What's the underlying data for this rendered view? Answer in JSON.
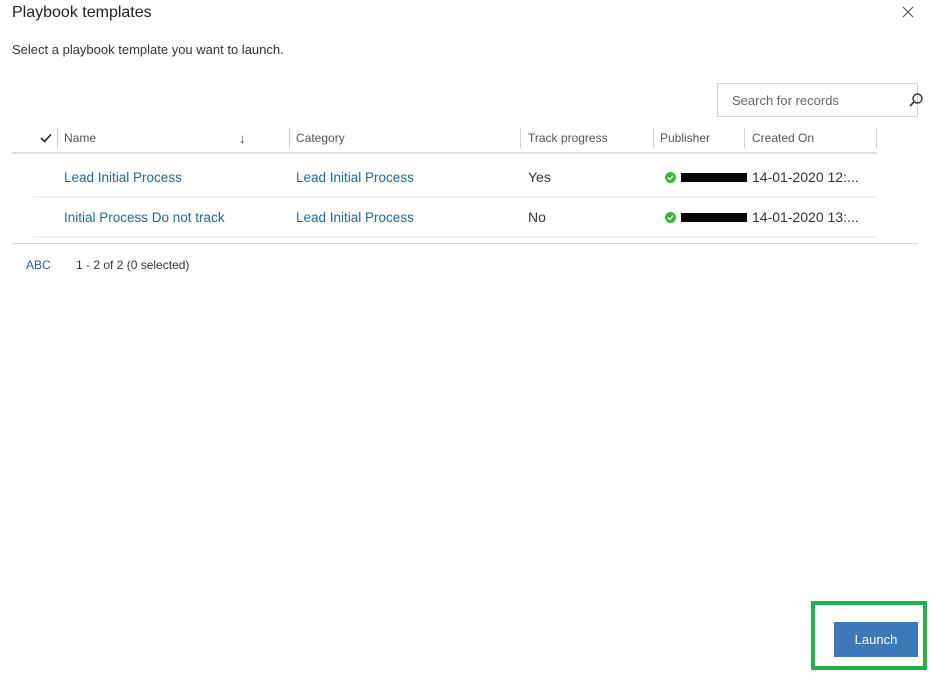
{
  "dialog": {
    "title": "Playbook templates",
    "subtitle": "Select a playbook template you want to launch.",
    "close_icon": "close-icon"
  },
  "search": {
    "placeholder": "Search for records",
    "value": ""
  },
  "grid": {
    "columns": [
      {
        "label": "Name",
        "sort": "descending"
      },
      {
        "label": "Category"
      },
      {
        "label": "Track progress"
      },
      {
        "label": "Publisher"
      },
      {
        "label": "Created On"
      }
    ],
    "rows": [
      {
        "name": "Lead Initial Process",
        "category": "Lead Initial Process",
        "track_progress": "Yes",
        "publisher": "[redacted]",
        "publisher_status": "online",
        "created_on": "14-01-2020 12:..."
      },
      {
        "name": "Initial Process Do not track",
        "category": "Lead Initial Process",
        "track_progress": "No",
        "publisher": "[redacted]",
        "publisher_status": "online",
        "created_on": "14-01-2020 13:..."
      }
    ]
  },
  "footer": {
    "jump_bar": "ABC",
    "record_count": "1 - 2 of 2 (0 selected)"
  },
  "actions": {
    "launch_label": "Launch"
  },
  "colors": {
    "link": "#2266a5",
    "primary_button": "#3d78b8",
    "highlight": "#22b04a",
    "status_online": "#3cb43c"
  }
}
